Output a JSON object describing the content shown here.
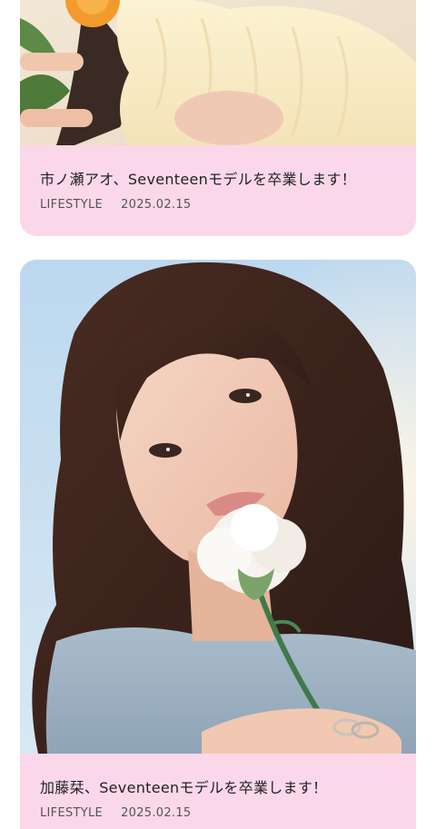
{
  "articles": [
    {
      "title": "市ノ瀬アオ、Seventeenモデルを卒業します！",
      "category": "LIFESTYLE",
      "date": "2025.02.15"
    },
    {
      "title": "加藤栞、Seventeenモデルを卒業します！",
      "category": "LIFESTYLE",
      "date": "2025.02.15"
    }
  ],
  "colors": {
    "card_background": "#fbd8e9",
    "text_primary": "#222222",
    "text_secondary": "#555555"
  }
}
